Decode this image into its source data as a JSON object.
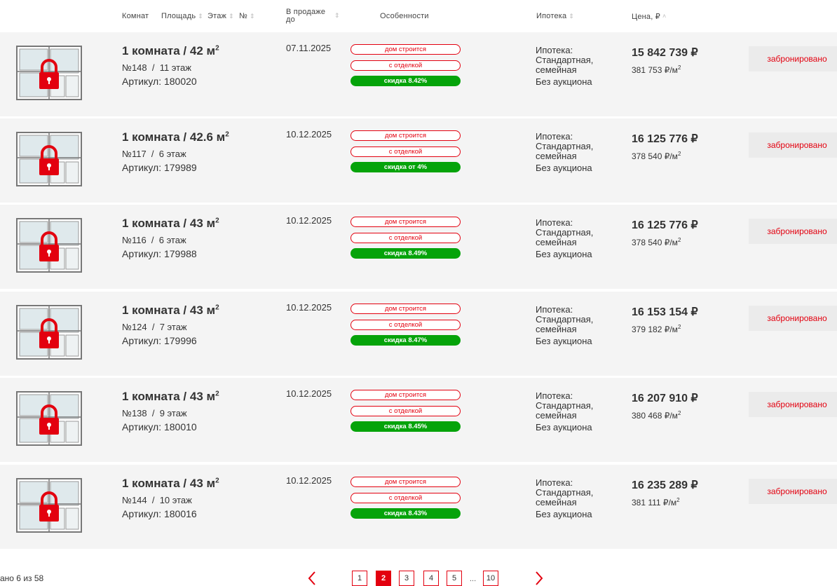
{
  "header": {
    "rooms": "Комнат",
    "area": "Площадь",
    "floor": "Этаж",
    "number": "№",
    "sale_until": "В продаже до",
    "features": "Особенности",
    "mortgage": "Ипотека",
    "price": "Цена, ₽"
  },
  "rows": [
    {
      "title": "1 комната /   42 м",
      "sup": "2",
      "number": "№148",
      "floor": "11 этаж",
      "article": "Артикул: 180020",
      "sale_date": "07.11.2025",
      "badge1": "дом строится",
      "badge2": "с отделкой",
      "badge3": "скидка 8.42%",
      "mortgage": "Ипотека: Стандартная, семейная",
      "auction": "Без аукциона",
      "price": "15 842 739 ₽",
      "ppm": "381 753 ₽/м",
      "status": "забронировано"
    },
    {
      "title": "1 комната /   42.6 м",
      "sup": "2",
      "number": "№117",
      "floor": "6 этаж",
      "article": "Артикул: 179989",
      "sale_date": "10.12.2025",
      "badge1": "дом строится",
      "badge2": "с отделкой",
      "badge3": "скидка от 4%",
      "mortgage": "Ипотека: Стандартная, семейная",
      "auction": "Без аукциона",
      "price": "16 125 776 ₽",
      "ppm": "378 540 ₽/м",
      "status": "забронировано"
    },
    {
      "title": "1 комната /   43 м",
      "sup": "2",
      "number": "№116",
      "floor": "6 этаж",
      "article": "Артикул: 179988",
      "sale_date": "10.12.2025",
      "badge1": "дом строится",
      "badge2": "с отделкой",
      "badge3": "скидка 8.49%",
      "mortgage": "Ипотека: Стандартная, семейная",
      "auction": "Без аукциона",
      "price": "16 125 776 ₽",
      "ppm": "378 540 ₽/м",
      "status": "забронировано"
    },
    {
      "title": "1 комната /   43 м",
      "sup": "2",
      "number": "№124",
      "floor": "7 этаж",
      "article": "Артикул: 179996",
      "sale_date": "10.12.2025",
      "badge1": "дом строится",
      "badge2": "с отделкой",
      "badge3": "скидка 8.47%",
      "mortgage": "Ипотека: Стандартная, семейная",
      "auction": "Без аукциона",
      "price": "16 153 154 ₽",
      "ppm": "379 182 ₽/м",
      "status": "забронировано"
    },
    {
      "title": "1 комната /   43 м",
      "sup": "2",
      "number": "№138",
      "floor": "9 этаж",
      "article": "Артикул: 180010",
      "sale_date": "10.12.2025",
      "badge1": "дом строится",
      "badge2": "с отделкой",
      "badge3": "скидка 8.45%",
      "mortgage": "Ипотека: Стандартная, семейная",
      "auction": "Без аукциона",
      "price": "16 207 910 ₽",
      "ppm": "380 468 ₽/м",
      "status": "забронировано"
    },
    {
      "title": "1 комната /   43 м",
      "sup": "2",
      "number": "№144",
      "floor": "10 этаж",
      "article": "Артикул: 180016",
      "sale_date": "10.12.2025",
      "badge1": "дом строится",
      "badge2": "с отделкой",
      "badge3": "скидка 8.43%",
      "mortgage": "Ипотека: Стандартная, семейная",
      "auction": "Без аукциона",
      "price": "16 235 289 ₽",
      "ppm": "381 111 ₽/м",
      "status": "забронировано"
    }
  ],
  "footer": {
    "count": "ано 6 из 58",
    "pages": [
      "1",
      "2",
      "3",
      "4",
      "5",
      "10"
    ],
    "dots": "...",
    "current_page": "2"
  },
  "colors": {
    "accent": "#e3000f",
    "discount": "#05a30a",
    "row_bg": "#f4f4f4"
  }
}
